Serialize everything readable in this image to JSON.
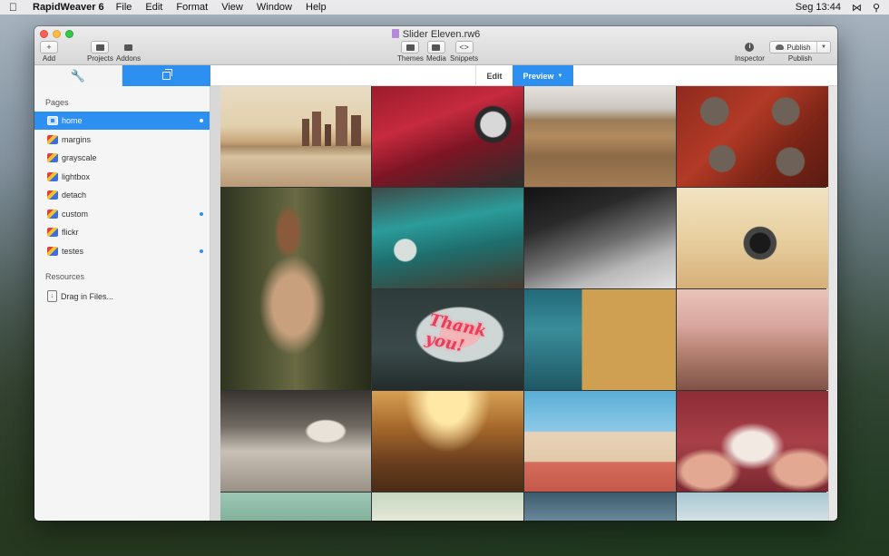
{
  "menubar": {
    "app_name": "RapidWeaver 6",
    "items": [
      "File",
      "Edit",
      "Format",
      "View",
      "Window",
      "Help"
    ],
    "clock": "Seg 13:44"
  },
  "window": {
    "title": "Slider Eleven.rw6"
  },
  "toolbar": {
    "add_label": "Add",
    "projects_label": "Projects",
    "addons_label": "Addons",
    "themes_label": "Themes",
    "media_label": "Media",
    "snippets_label": "Snippets",
    "inspector_label": "Inspector",
    "publish_button": "Publish",
    "publish_label": "Publish"
  },
  "modebar": {
    "edit_label": "Edit",
    "preview_label": "Preview"
  },
  "sidebar": {
    "pages_header": "Pages",
    "pages": [
      {
        "label": "home",
        "selected": true,
        "dot": true
      },
      {
        "label": "margins",
        "selected": false,
        "dot": false
      },
      {
        "label": "grayscale",
        "selected": false,
        "dot": false
      },
      {
        "label": "lightbox",
        "selected": false,
        "dot": false
      },
      {
        "label": "detach",
        "selected": false,
        "dot": false
      },
      {
        "label": "custom",
        "selected": false,
        "dot": true
      },
      {
        "label": "flickr",
        "selected": false,
        "dot": false
      },
      {
        "label": "testes",
        "selected": false,
        "dot": true
      }
    ],
    "resources_header": "Resources",
    "drag_label": "Drag in Files..."
  },
  "preview": {
    "neon_text": "Thank you!"
  },
  "colors": {
    "accent": "#2d8ff0"
  }
}
